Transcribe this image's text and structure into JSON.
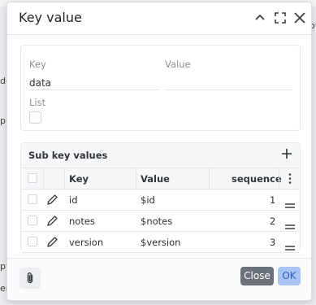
{
  "dialog": {
    "title": "Key value",
    "icons": [
      "chevron-up-icon",
      "fullscreen-icon",
      "close-icon"
    ]
  },
  "form": {
    "key_label": "Key",
    "key_value": "data",
    "value_label": "Value",
    "value_value": "",
    "list_label": "List",
    "list_checked": false
  },
  "sub_key_values": {
    "title": "Sub key values",
    "columns": [
      "Key",
      "Value",
      "sequence"
    ],
    "rows": [
      {
        "key": "id",
        "value": "$id",
        "sequence": "1"
      },
      {
        "key": "notes",
        "value": "$notes",
        "sequence": "2"
      },
      {
        "key": "version",
        "value": "$version",
        "sequence": "3"
      }
    ]
  },
  "footer": {
    "close_label": "Close",
    "ok_label": "OK"
  },
  "background": {
    "fragments": [
      "of",
      "de",
      "pu",
      "pt",
      "en"
    ]
  },
  "colors": {
    "ok_bg": "#a9c4f5",
    "close_bg": "#6c727a"
  }
}
